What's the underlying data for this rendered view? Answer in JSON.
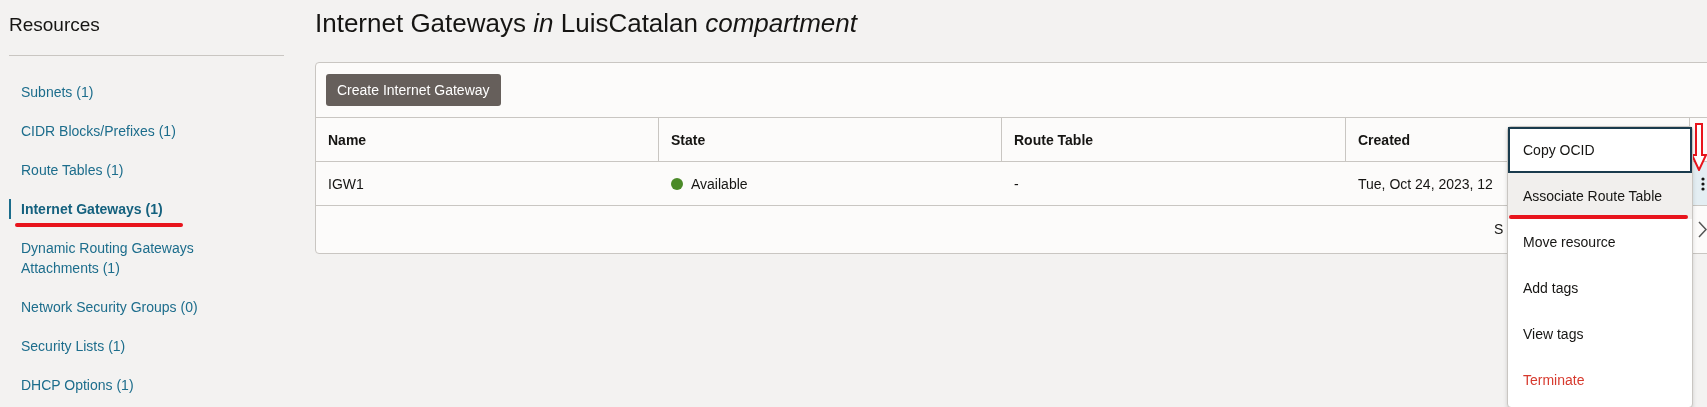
{
  "sidebar": {
    "title": "Resources",
    "items": [
      {
        "label": "Subnets (1)",
        "selected": false,
        "annotated": false
      },
      {
        "label": "CIDR Blocks/Prefixes (1)",
        "selected": false,
        "annotated": false
      },
      {
        "label": "Route Tables (1)",
        "selected": false,
        "annotated": false
      },
      {
        "label": "Internet Gateways (1)",
        "selected": true,
        "annotated": true
      },
      {
        "label": "Dynamic Routing Gateways Attachments (1)",
        "selected": false,
        "annotated": false
      },
      {
        "label": "Network Security Groups (0)",
        "selected": false,
        "annotated": false
      },
      {
        "label": "Security Lists (1)",
        "selected": false,
        "annotated": false
      },
      {
        "label": "DHCP Options (1)",
        "selected": false,
        "annotated": false
      }
    ]
  },
  "page_title": "Internet Gateways *in* LuisCatalan *compartment*",
  "create_button": "Create Internet Gateway",
  "table": {
    "columns": [
      "Name",
      "State",
      "Route Table",
      "Created"
    ],
    "rows": [
      {
        "name": "IGW1",
        "state": "Available",
        "color": "#4b8a28",
        "route_table": "-",
        "created": "Tue, Oct 24, 2023, 12"
      }
    ],
    "footer_text": "S"
  },
  "menu": {
    "items": [
      {
        "label": "Copy OCID",
        "kind": "normal",
        "focused": true,
        "hovered": false,
        "annotated": false
      },
      {
        "label": "Associate Route Table",
        "kind": "normal",
        "focused": false,
        "hovered": true,
        "annotated": true
      },
      {
        "label": "Move resource",
        "kind": "normal",
        "focused": false,
        "hovered": false,
        "annotated": false
      },
      {
        "label": "Add tags",
        "kind": "normal",
        "focused": false,
        "hovered": false,
        "annotated": false
      },
      {
        "label": "View tags",
        "kind": "normal",
        "focused": false,
        "hovered": false,
        "annotated": false
      },
      {
        "label": "Terminate",
        "kind": "danger",
        "focused": false,
        "hovered": false,
        "annotated": false
      }
    ]
  }
}
